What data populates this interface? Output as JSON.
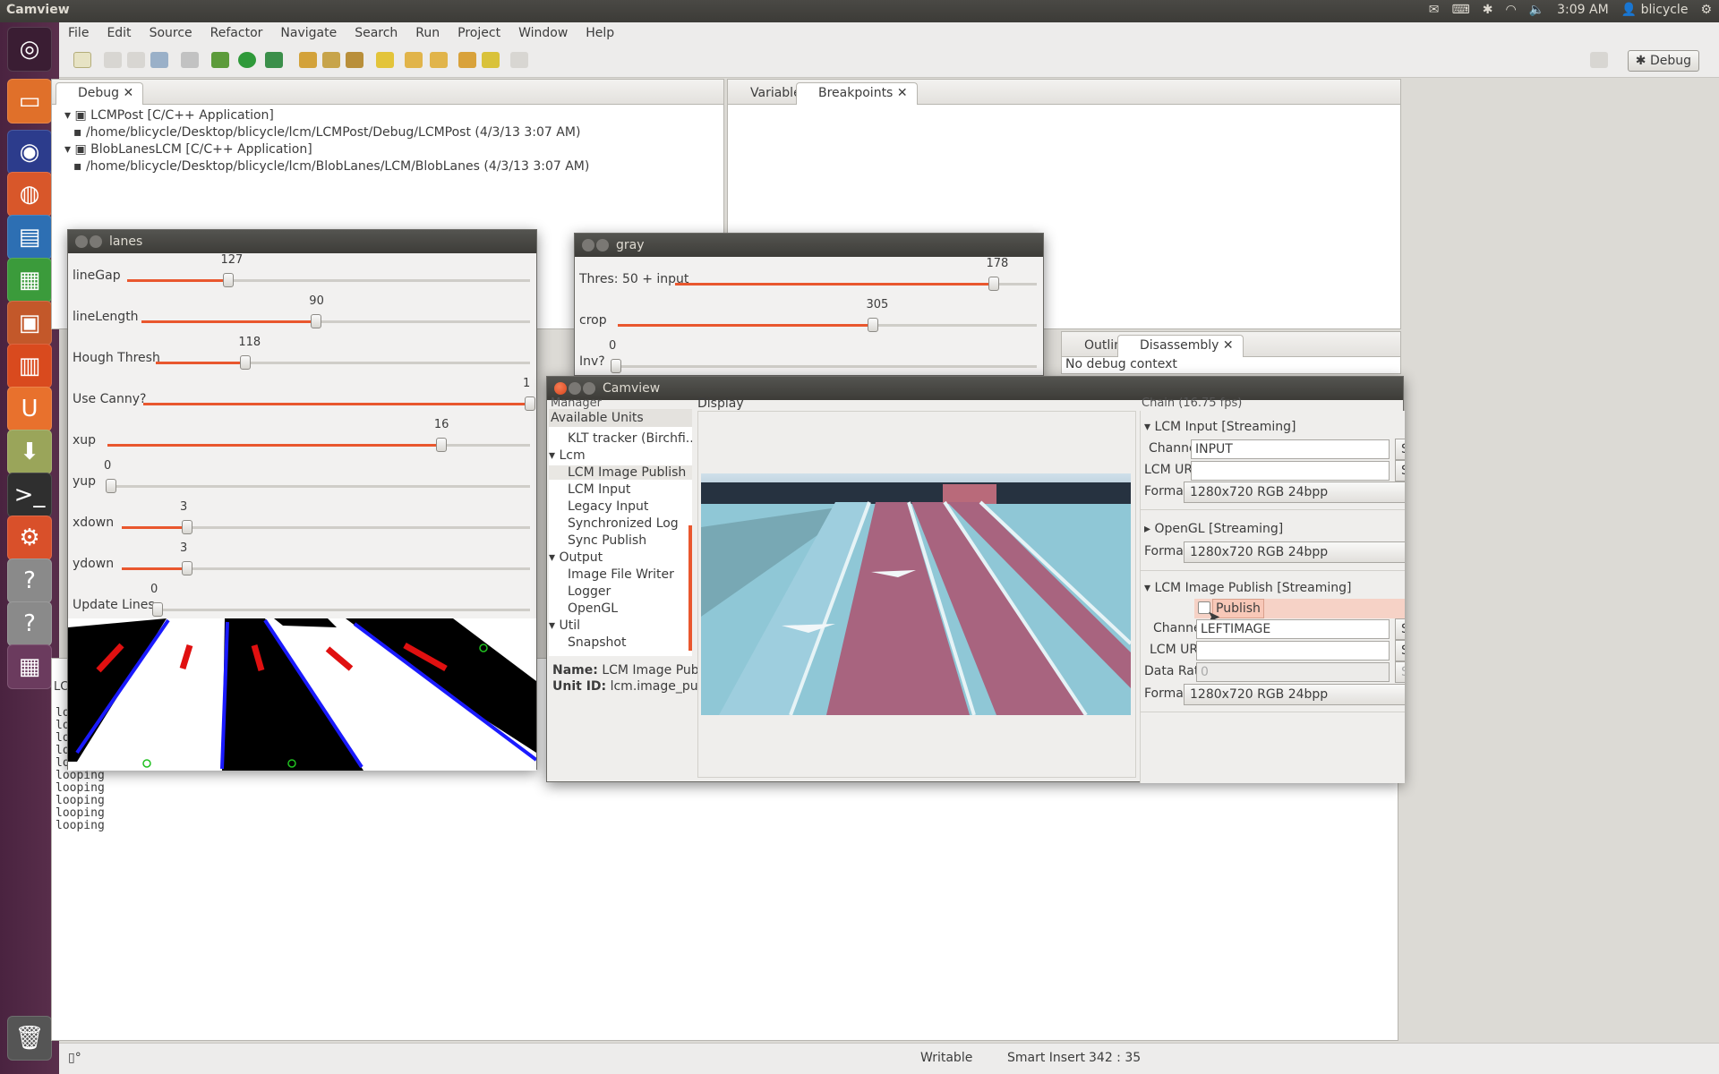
{
  "top_panel": {
    "app_name": "Camview",
    "time": "3:09 AM",
    "user": "blicycle"
  },
  "menubar": [
    "File",
    "Edit",
    "Source",
    "Refactor",
    "Navigate",
    "Search",
    "Run",
    "Project",
    "Window",
    "Help"
  ],
  "toolbar": {
    "perspective_label": "Debug"
  },
  "debug_view": {
    "tab": "Debug",
    "items": [
      "LCMPost [C/C++ Application]",
      "/home/blicycle/Desktop/blicycle/lcm/LCMPost/Debug/LCMPost (4/3/13 3:07 AM)",
      "BlobLanesLCM [C/C++ Application]",
      "/home/blicycle/Desktop/blicycle/lcm/BlobLanes/LCM/BlobLanes (4/3/13 3:07 AM)"
    ]
  },
  "vars_view": {
    "tab_variables": "Variables",
    "tab_breakpoints": "Breakpoints"
  },
  "outline_view": {
    "tab_outline": "Outline",
    "tab_disassembly": "Disassembly",
    "context": "No debug context"
  },
  "lanes_window": {
    "title": "lanes",
    "sliders": [
      {
        "label": "lineGap",
        "value": "127",
        "fraction": 0.25
      },
      {
        "label": "lineLength",
        "value": "90",
        "fraction": 0.45
      },
      {
        "label": "Hough Thresh",
        "value": "118",
        "fraction": 0.24
      },
      {
        "label": "Use Canny?",
        "value": "1",
        "fraction": 1.0
      },
      {
        "label": "xup",
        "value": "16",
        "fraction": 0.79
      },
      {
        "label": "yup",
        "value": "0",
        "fraction": 0.0
      },
      {
        "label": "xdown",
        "value": "3",
        "fraction": 0.16
      },
      {
        "label": "ydown",
        "value": "3",
        "fraction": 0.16
      },
      {
        "label": "Update Lines",
        "value": "0",
        "fraction": 0.0
      }
    ]
  },
  "gray_window": {
    "title": "gray",
    "sliders": [
      {
        "label": "Thres: 50 + input",
        "value": "178",
        "fraction": 0.88
      },
      {
        "label": "crop",
        "value": "305",
        "fraction": 0.61
      },
      {
        "label": "Inv?",
        "value": "0",
        "fraction": 0.0
      }
    ]
  },
  "console_lines": [
    "loo",
    "loo",
    "loo",
    "loo",
    "loo",
    "looping",
    "looping",
    "looping",
    "looping",
    "looping"
  ],
  "console_label": "LC",
  "camview": {
    "title": "Camview",
    "manager_label": "Manager",
    "available_units": "Available Units",
    "units_top": "KLT tracker (Birchfi...",
    "groups": [
      {
        "name": "Lcm",
        "items": [
          "LCM Image Publish",
          "LCM Input",
          "Legacy Input",
          "Synchronized Log",
          "Sync Publish"
        ]
      },
      {
        "name": "Output",
        "items": [
          "Image File Writer",
          "Logger",
          "OpenGL"
        ]
      },
      {
        "name": "Util",
        "items": [
          "Snapshot"
        ]
      }
    ],
    "info_name_label": "Name:",
    "info_name": "LCM Image Publish",
    "info_unit_label": "Unit ID:",
    "info_unit": "lcm.image_publish",
    "display_label": "Display",
    "chain_label": "Chain (16.75 fps)",
    "chain": {
      "lcm_input": {
        "header": "LCM Input [Streaming]",
        "channel_label": "Channel:",
        "channel": "INPUT",
        "url_label": "LCM URL:",
        "url": "",
        "format_label": "Format:",
        "format": "1280x720 RGB 24bpp"
      },
      "opengl": {
        "header": "OpenGL [Streaming]",
        "format_label": "Format:",
        "format": "1280x720 RGB 24bpp"
      },
      "image_publish": {
        "header": "LCM Image Publish [Streaming]",
        "publish_label": "Publish",
        "channel_label": "Channel:",
        "channel": "LEFTIMAGE",
        "url_label": "LCM URL:",
        "url": "",
        "rate_label": "Data Rate:",
        "rate": "0",
        "format_label": "Format:",
        "format": "1280x720 RGB 24bpp"
      },
      "set_label": "Se"
    }
  },
  "statusbar": {
    "writable": "Writable",
    "insert": "Smart Insert",
    "position": "342 : 35"
  }
}
